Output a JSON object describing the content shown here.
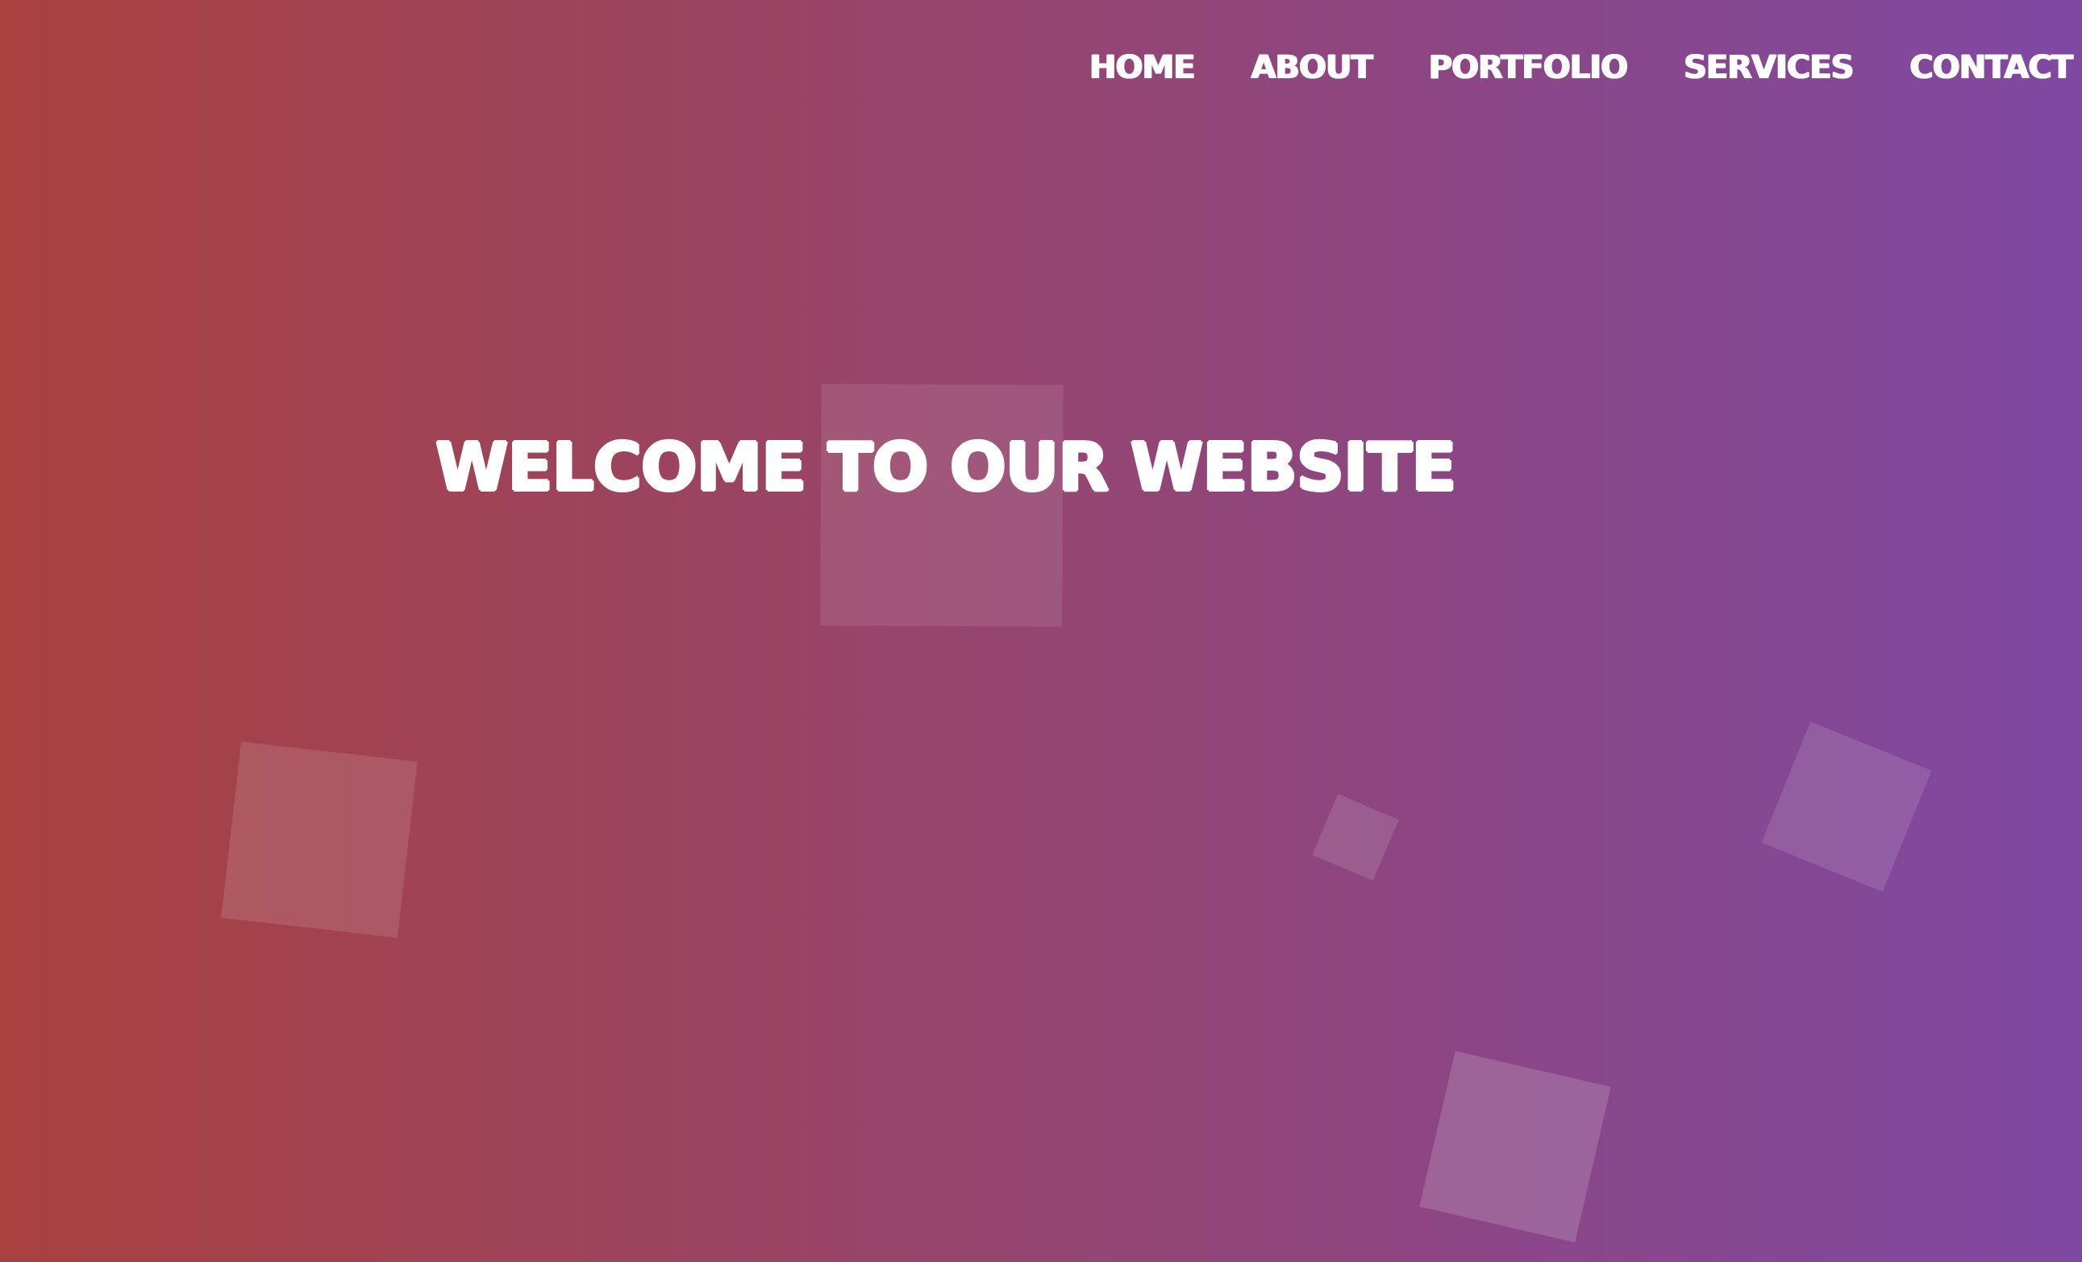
{
  "nav": {
    "items": [
      {
        "label": "HOME"
      },
      {
        "label": "ABOUT"
      },
      {
        "label": "PORTFOLIO"
      },
      {
        "label": "SERVICES"
      },
      {
        "label": "CONTACT"
      }
    ]
  },
  "hero": {
    "title": "WELCOME TO OUR WEBSITE"
  },
  "colors": {
    "gradient_start": "#a8413f",
    "gradient_end": "#7f48a2",
    "text": "#ffffff"
  }
}
